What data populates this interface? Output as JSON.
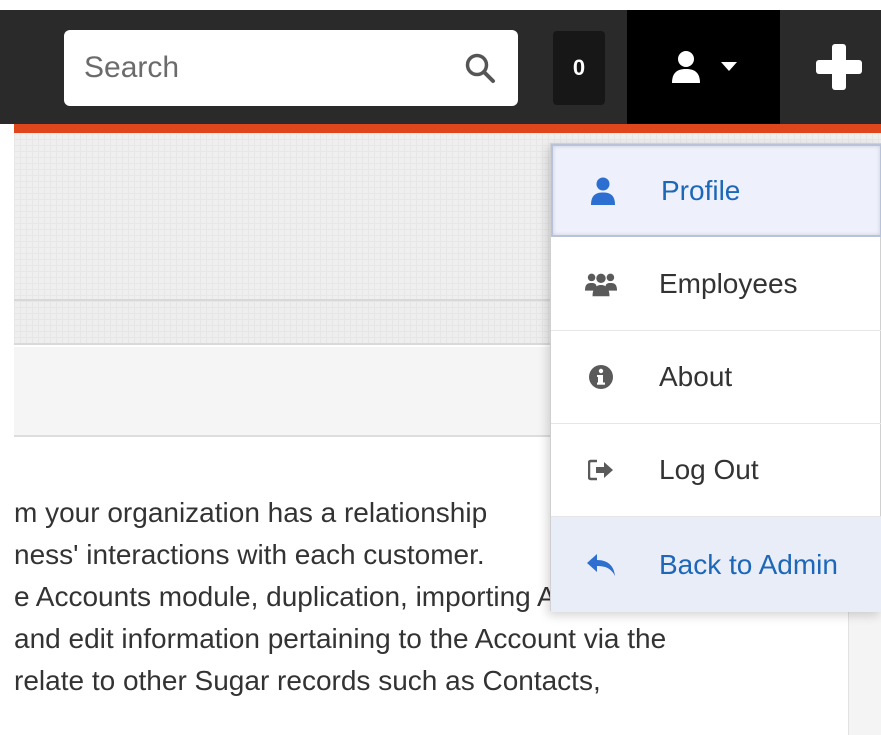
{
  "header": {
    "search_placeholder": "Search",
    "notification_count": "0",
    "accent_color": "#e0461b"
  },
  "user_menu": {
    "items": [
      {
        "label": "Profile",
        "icon": "user-icon"
      },
      {
        "label": "Employees",
        "icon": "users-icon"
      },
      {
        "label": "About",
        "icon": "info-icon"
      },
      {
        "label": "Log Out",
        "icon": "logout-icon"
      },
      {
        "label": "Back to Admin",
        "icon": "reply-icon"
      }
    ]
  },
  "content": {
    "lines": [
      "m your organization has a relationship",
      "ness' interactions with each customer.",
      "e Accounts module, duplication, importing Accounts,",
      " and edit information pertaining to the Account via the",
      "relate to other Sugar records such as Contacts,"
    ]
  }
}
